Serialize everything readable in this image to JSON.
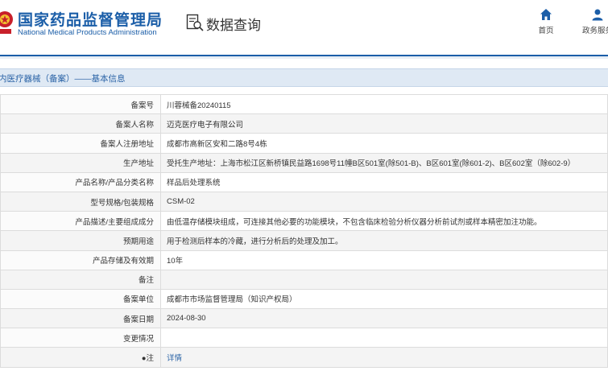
{
  "header": {
    "logo_cn": "国家药品监督管理局",
    "logo_en": "National Medical Products Administration",
    "query_title": "数据查询",
    "nav": [
      {
        "label": "首页"
      },
      {
        "label": "政务服务"
      }
    ]
  },
  "section": {
    "title": "内医疗器械（备案）——基本信息"
  },
  "record": {
    "rows": [
      {
        "label": "备案号",
        "value": "川蓉械备20240115"
      },
      {
        "label": "备案人名称",
        "value": "迈克医疗电子有限公司"
      },
      {
        "label": "备案人注册地址",
        "value": "成都市高新区安和二路8号4栋"
      },
      {
        "label": "生产地址",
        "value": "受托生产地址：上海市松江区新桥镇民益路1698号11幢B区501室(除501-B)、B区601室(除601-2)、B区602室（除602-9）"
      },
      {
        "label": "产品名称/产品分类名称",
        "value": "样品后处理系统"
      },
      {
        "label": "型号规格/包装规格",
        "value": "CSM-02"
      },
      {
        "label": "产品描述/主要组成成分",
        "value": "由低温存储模块组成，可连接其他必要的功能模块，不包含临床检验分析仪器分析前试剂或样本精密加注功能。"
      },
      {
        "label": "预期用途",
        "value": "用于检测后样本的冷藏，进行分析后的处理及加工。"
      },
      {
        "label": "产品存储及有效期",
        "value": "10年"
      },
      {
        "label": "备注",
        "value": ""
      },
      {
        "label": "备案单位",
        "value": "成都市市场监督管理局（知识产权局）"
      },
      {
        "label": "备案日期",
        "value": "2024-08-30"
      },
      {
        "label": "变更情况",
        "value": ""
      },
      {
        "label": "注",
        "value": "详情"
      }
    ]
  }
}
